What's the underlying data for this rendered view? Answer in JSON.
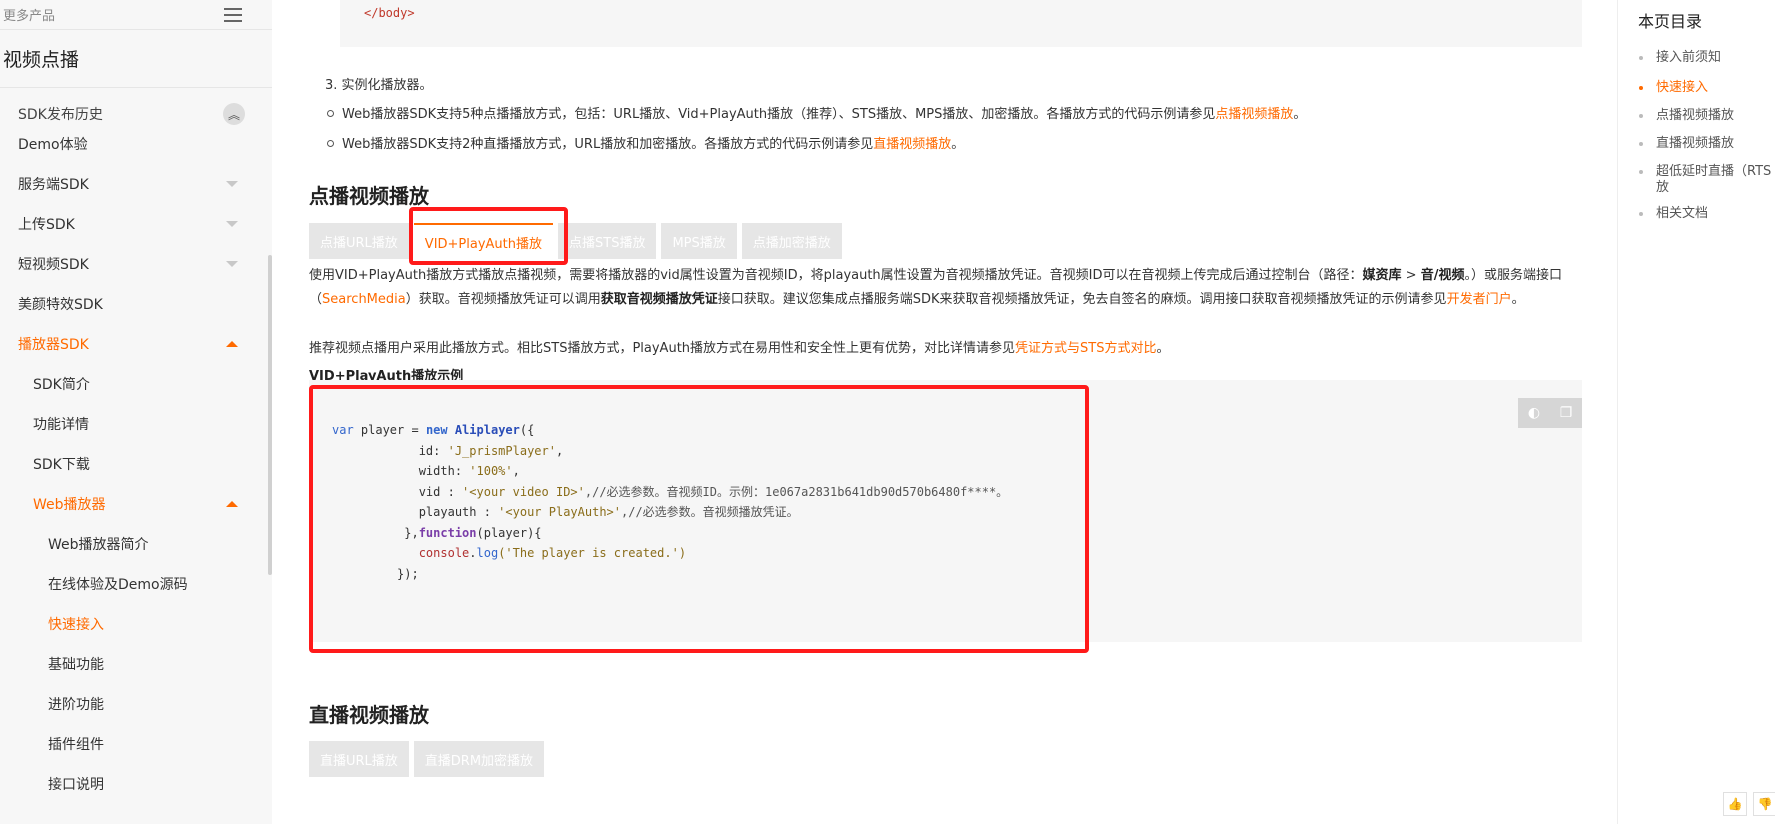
{
  "sidebar": {
    "more_products": "更多产品",
    "product_title": "视频点播",
    "items": [
      {
        "label": "SDK发布历史",
        "level": 1,
        "partial": true
      },
      {
        "label": "Demo体验",
        "level": 1
      },
      {
        "label": "服务端SDK",
        "level": 1,
        "chevron": "down"
      },
      {
        "label": "上传SDK",
        "level": 1,
        "chevron": "down"
      },
      {
        "label": "短视频SDK",
        "level": 1,
        "chevron": "down"
      },
      {
        "label": "美颜特效SDK",
        "level": 1
      },
      {
        "label": "播放器SDK",
        "level": 1,
        "chevron": "up",
        "active": true
      },
      {
        "label": "SDK简介",
        "level": 2
      },
      {
        "label": "功能详情",
        "level": 2
      },
      {
        "label": "SDK下载",
        "level": 2
      },
      {
        "label": "Web播放器",
        "level": 2,
        "chevron": "up",
        "active": true
      },
      {
        "label": "Web播放器简介",
        "level": 3
      },
      {
        "label": "在线体验及Demo源码",
        "level": 3
      },
      {
        "label": "快速接入",
        "level": 3,
        "active": true
      },
      {
        "label": "基础功能",
        "level": 3
      },
      {
        "label": "进阶功能",
        "level": 3
      },
      {
        "label": "插件组件",
        "level": 3
      },
      {
        "label": "接口说明",
        "level": 3
      }
    ]
  },
  "content": {
    "code_top_tag": "</body>",
    "step3": "3. 实例化播放器。",
    "bullet1_text": "Web播放器SDK支持5种点播播放方式，包括：URL播放、Vid+PlayAuth播放（推荐）、STS播放、MPS播放、加密播放。各播放方式的代码示例请参见",
    "bullet1_link": "点播视频播放",
    "bullet1_end": "。",
    "bullet2_text": "Web播放器SDK支持2种直播播放方式，URL播放和加密播放。各播放方式的代码示例请参见",
    "bullet2_link": "直播视频播放",
    "bullet2_end": "。",
    "vod_heading": "点播视频播放",
    "vod_tabs": [
      "点播URL播放",
      "VID+PlayAuth播放",
      "点播STS播放",
      "MPS播放",
      "点播加密播放"
    ],
    "vod_active_tab": 1,
    "para1_a": "使用VID+PlayAuth播放方式播放点播视频，需要将播放器的vid属性设置为音视频ID，将playauth属性设置为音视频播放凭证。音视频ID可以在音视频上传完成后通过控制台（路径：",
    "para1_b1": "媒资库",
    "para1_b2": " > ",
    "para1_b3": "音/视频",
    "para1_c": "。）或服务端接口（",
    "para1_link1": "SearchMedia",
    "para1_d": "）获取。音视频播放凭证可以调用",
    "para1_bold2": "获取音视频播放凭证",
    "para1_e": "接口获取。建议您集成点播服务端SDK来获取音视频播放凭证，免去自签名的麻烦。调用接口获取音视频播放凭证的示例请参见",
    "para1_link2": "开发者门户",
    "para1_f": "。",
    "para2_a": "推荐视频点播用户采用此播放方式。相比STS播放方式，PlayAuth播放方式在易用性和安全性上更有优势，对比详情请参见",
    "para2_link": "凭证方式与STS方式对比",
    "para2_end": "。",
    "example_title": "VID+PlayAuth播放示例",
    "code": {
      "l1_kw": "var",
      "l1_a": " player = ",
      "l1_new": "new",
      "l1_sp": " ",
      "l1_fn": "Aliplayer",
      "l1_b": "({",
      "l2_a": "            id: ",
      "l2_s": "'J_prismPlayer'",
      "l2_b": ",",
      "l3_a": "            width: ",
      "l3_s": "'100%'",
      "l3_b": ",",
      "l4_a": "            vid : ",
      "l4_s": "'<your video ID>'",
      "l4_b": ",//必选参数。音视频ID。示例：1e067a2831b641db90d570b6480f****。",
      "l5_a": "            playauth : ",
      "l5_s": "'<your PlayAuth>'",
      "l5_b": ",//必选参数。音视频播放凭证。",
      "l6_a": "          },",
      "l6_fn": "function",
      "l6_b": "(player){",
      "l7_a": "            ",
      "l7_obj": "console",
      "l7_dot": ".",
      "l7_meth": "log",
      "l7_s": "('The player is created.')",
      "l8_a": "         });"
    },
    "live_heading": "直播视频播放",
    "live_tabs": [
      "直播URL播放",
      "直播DRM加密播放"
    ]
  },
  "toc": {
    "title": "本页目录",
    "items": [
      {
        "label": "接入前须知"
      },
      {
        "label": "快速接入",
        "active": true
      },
      {
        "label": "点播视频播放"
      },
      {
        "label": "直播视频播放"
      },
      {
        "label": "超低延时直播（RTS",
        "label2": "放"
      },
      {
        "label": "相关文档"
      }
    ]
  },
  "colors": {
    "accent": "#ff6a00",
    "highlight": "#ff1a1a"
  }
}
